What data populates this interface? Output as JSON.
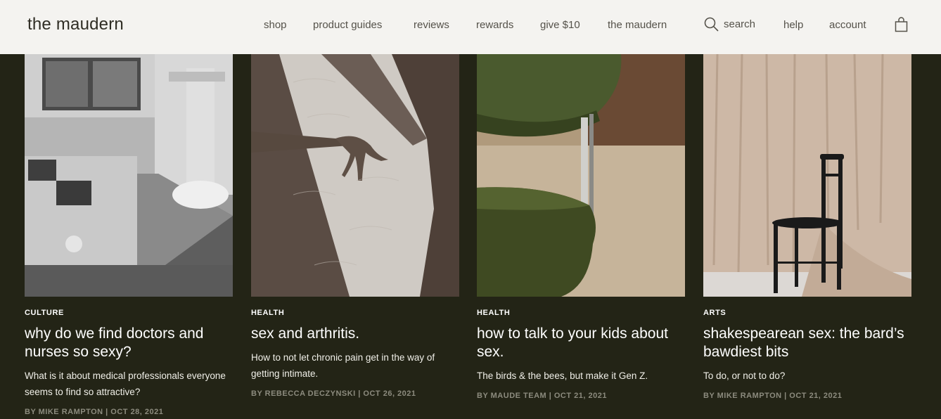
{
  "header": {
    "logo": "the maudern",
    "nav": [
      "shop",
      "product guides",
      "reviews",
      "rewards",
      "give $10",
      "the maudern"
    ],
    "search_label": "search",
    "help_label": "help",
    "account_label": "account",
    "icons": {
      "search": "search-icon",
      "bag": "shopping-bag-icon"
    },
    "colors": {
      "header_bg": "#f4f3f0",
      "page_bg": "#232416"
    }
  },
  "articles": [
    {
      "category": "CULTURE",
      "title": "why do we find doctors and nurses so sexy?",
      "description": "What is it about medical professionals everyone seems to find so attractive?",
      "byline": "BY MIKE RAMPTON | OCT 28, 2021"
    },
    {
      "category": "HEALTH",
      "title": "sex and arthritis.",
      "description": "How to not let chronic pain get in the way of getting intimate.",
      "byline": "BY REBECCA DECZYNSKI | OCT 26, 2021"
    },
    {
      "category": "HEALTH",
      "title": "how to talk to your kids about sex.",
      "description": "The birds & the bees, but make it Gen Z.",
      "byline": "BY MAUDE TEAM | OCT 21, 2021"
    },
    {
      "category": "ARTS",
      "title": "shakespearean sex: the bard’s bawdiest bits",
      "description": "To do, or not to do?",
      "byline": "BY MIKE RAMPTON | OCT 21, 2021"
    }
  ]
}
